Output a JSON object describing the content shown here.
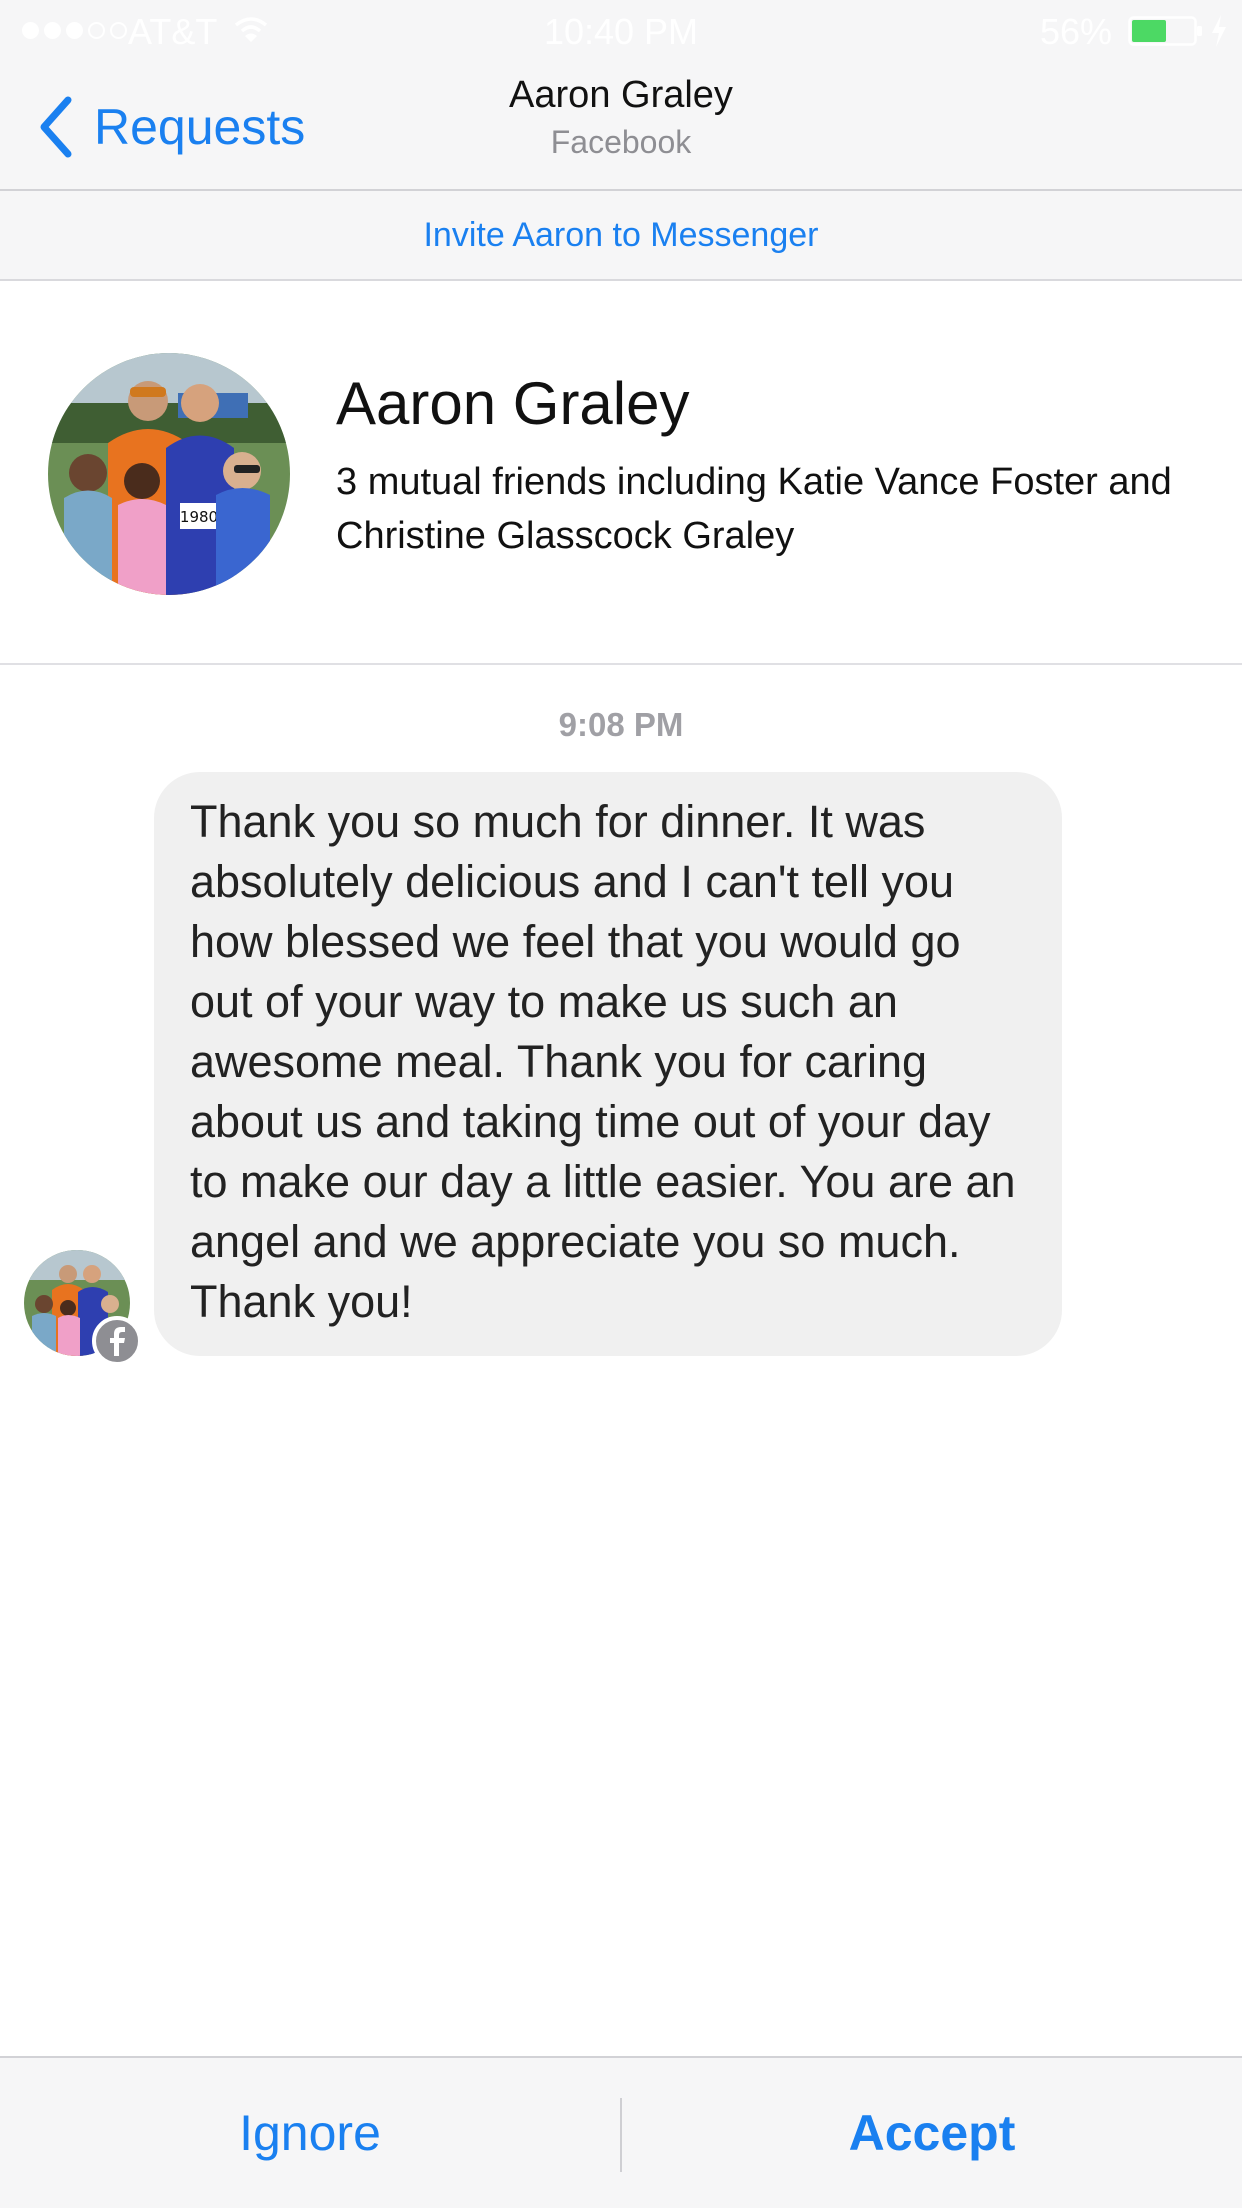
{
  "status_bar": {
    "carrier": "AT&T",
    "time": "10:40 PM",
    "battery_percent": "56%",
    "battery_level": 0.56,
    "signal_bars_filled": 3,
    "signal_bars_total": 5
  },
  "nav": {
    "back_label": "Requests",
    "title": "Aaron Graley",
    "subtitle": "Facebook"
  },
  "invite": {
    "label": "Invite Aaron to Messenger"
  },
  "profile": {
    "name": "Aaron Graley",
    "mutual_friends": "3 mutual friends including Katie Vance Foster and Christine Glasscock Graley",
    "photo_jersey_number": "1980"
  },
  "conversation": {
    "timestamp": "9:08 PM",
    "message": "Thank you so much for dinner. It was absolutely delicious and I can't tell you how blessed we feel that you would go out of your way to make us such an awesome meal. Thank you for caring about us and taking time out of your day to make our day a little easier. You are an angel and we appreciate you so much. Thank you!"
  },
  "actions": {
    "ignore_label": "Ignore",
    "accept_label": "Accept"
  },
  "colors": {
    "accent": "#1a80f0",
    "bubble": "#f0f0f0",
    "battery": "#4cd964"
  },
  "icons": {
    "back": "chevron-left-icon",
    "wifi": "wifi-icon",
    "battery": "battery-icon",
    "charging": "charging-bolt-icon",
    "facebook_badge": "facebook-icon"
  }
}
